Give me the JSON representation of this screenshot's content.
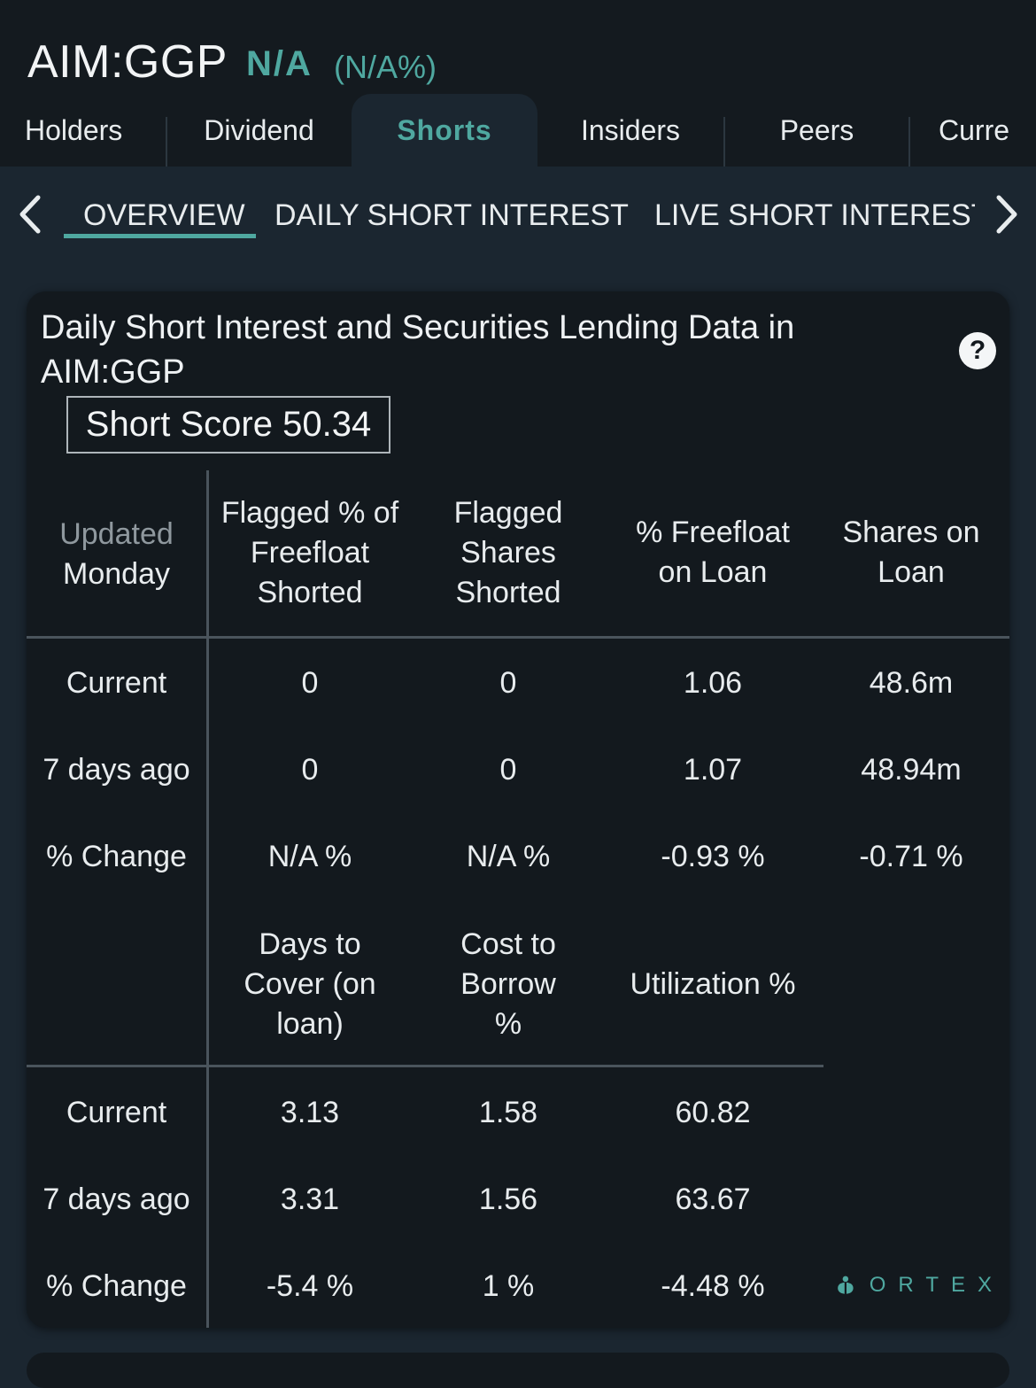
{
  "header": {
    "ticker": "AIM:GGP",
    "price": "N/A",
    "change": "(N/A%)"
  },
  "tabs": [
    {
      "label": "Holders"
    },
    {
      "label": "Dividend"
    },
    {
      "label": "Shorts",
      "active": true
    },
    {
      "label": "Insiders"
    },
    {
      "label": "Peers"
    },
    {
      "label": "Curre"
    }
  ],
  "subtabs": [
    {
      "label": "OVERVIEW",
      "active": true
    },
    {
      "label": "DAILY SHORT INTEREST"
    },
    {
      "label": "LIVE SHORT INTEREST"
    }
  ],
  "card": {
    "title": "Daily Short Interest and Securities Lending Data in AIM:GGP",
    "help": "?",
    "short_score": "Short Score 50.34",
    "table1": {
      "updated_label": "Updated",
      "updated_day": "Monday",
      "headers": [
        "Flagged % of Freefloat Shorted",
        "Flagged Shares Shorted",
        "% Freefloat on Loan",
        "Shares on Loan"
      ],
      "rows": [
        {
          "label": "Current",
          "values": [
            "0",
            "0",
            "1.06",
            "48.6m"
          ]
        },
        {
          "label": "7 days ago",
          "values": [
            "0",
            "0",
            "1.07",
            "48.94m"
          ]
        },
        {
          "label": "% Change",
          "values": [
            "N/A %",
            "N/A %",
            "-0.93 %",
            "-0.71 %"
          ]
        }
      ]
    },
    "table2": {
      "headers": [
        "Days to Cover (on loan)",
        "Cost to Borrow %",
        "Utilization %"
      ],
      "rows": [
        {
          "label": "Current",
          "values": [
            "3.13",
            "1.58",
            "60.82"
          ]
        },
        {
          "label": "7 days ago",
          "values": [
            "3.31",
            "1.56",
            "63.67"
          ]
        },
        {
          "label": "% Change",
          "values": [
            "-5.4 %",
            "1 %",
            "-4.48 %"
          ]
        }
      ]
    },
    "logo_text": "ORTEX"
  },
  "colors": {
    "accent": "#4fa8a0",
    "header_bg": "#141a1f",
    "page_bg": "#1b2630",
    "card_bg": "#13191e"
  }
}
